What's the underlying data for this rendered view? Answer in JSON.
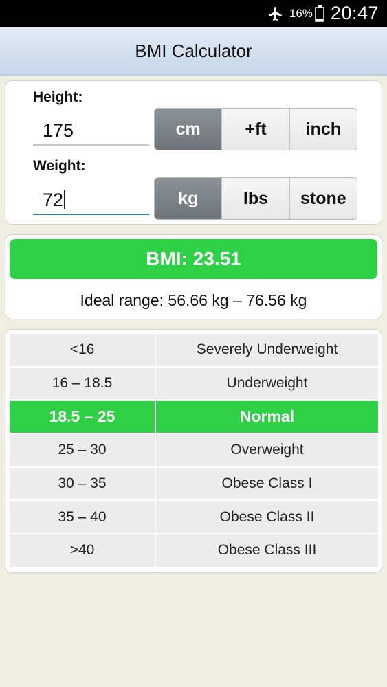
{
  "status_bar": {
    "battery_percent": "16%",
    "time": "20:47"
  },
  "app_title": "BMI Calculator",
  "height": {
    "label": "Height:",
    "value": "175",
    "units": [
      "cm",
      "+ft",
      "inch"
    ],
    "selected_unit": "cm"
  },
  "weight": {
    "label": "Weight:",
    "value": "72",
    "units": [
      "kg",
      "lbs",
      "stone"
    ],
    "selected_unit": "kg"
  },
  "result": {
    "bmi_text": "BMI: 23.51",
    "ideal_range": "Ideal range: 56.66 kg – 76.56 kg"
  },
  "table": {
    "rows": [
      {
        "range": "<16",
        "category": "Severely Underweight",
        "highlight": false
      },
      {
        "range": "16 – 18.5",
        "category": "Underweight",
        "highlight": false
      },
      {
        "range": "18.5 – 25",
        "category": "Normal",
        "highlight": true
      },
      {
        "range": "25 – 30",
        "category": "Overweight",
        "highlight": false
      },
      {
        "range": "30 – 35",
        "category": "Obese Class I",
        "highlight": false
      },
      {
        "range": "35 – 40",
        "category": "Obese Class II",
        "highlight": false
      },
      {
        "range": ">40",
        "category": "Obese Class III",
        "highlight": false
      }
    ]
  },
  "colors": {
    "accent_green": "#2ed145",
    "selected_segment": "#7b8186",
    "appbar": "#c5d7e9"
  },
  "icons": {
    "airplane": "airplane-mode-icon",
    "battery": "battery-icon"
  }
}
